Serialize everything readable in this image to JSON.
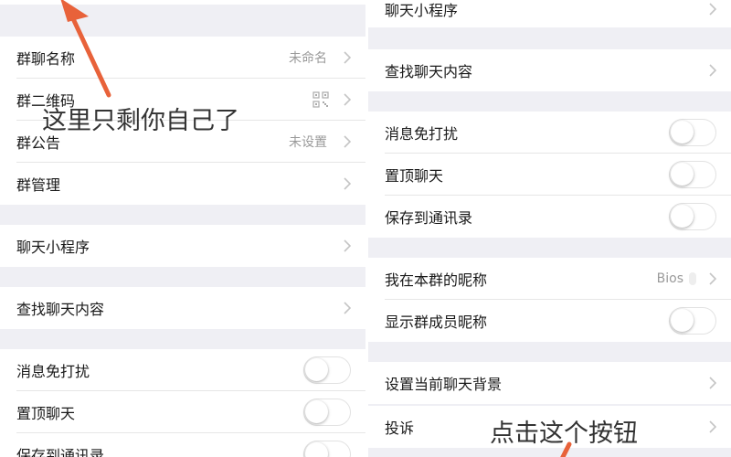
{
  "left": {
    "rows": [
      {
        "label": "群聊名称",
        "value": "未命名"
      },
      {
        "label": "群二维码"
      },
      {
        "label": "群公告",
        "value": "未设置"
      },
      {
        "label": "群管理"
      },
      {
        "label": "聊天小程序"
      },
      {
        "label": "查找聊天内容"
      },
      {
        "label": "消息免打扰",
        "toggle": false
      },
      {
        "label": "置顶聊天",
        "toggle": false
      },
      {
        "label": "保存到通讯录",
        "toggle": false
      }
    ],
    "annotation": "这里只剩你自己了"
  },
  "right": {
    "rows": [
      {
        "label": "聊天小程序"
      },
      {
        "label": "查找聊天内容"
      },
      {
        "label": "消息免打扰",
        "toggle": false
      },
      {
        "label": "置顶聊天",
        "toggle": false
      },
      {
        "label": "保存到通讯录",
        "toggle": false
      },
      {
        "label": "我在本群的昵称",
        "value": "Bios"
      },
      {
        "label": "显示群成员昵称",
        "toggle": false
      },
      {
        "label": "设置当前聊天背景"
      },
      {
        "label": "投诉"
      }
    ],
    "annotation": "点击这个按钮"
  },
  "colors": {
    "background": "#efeff4",
    "text": "#1a1a1a",
    "secondary": "#9a9a9a",
    "arrow": "#e8623a"
  },
  "icons": {
    "chevron": "chevron-right-icon",
    "qr": "qr-code-icon"
  }
}
